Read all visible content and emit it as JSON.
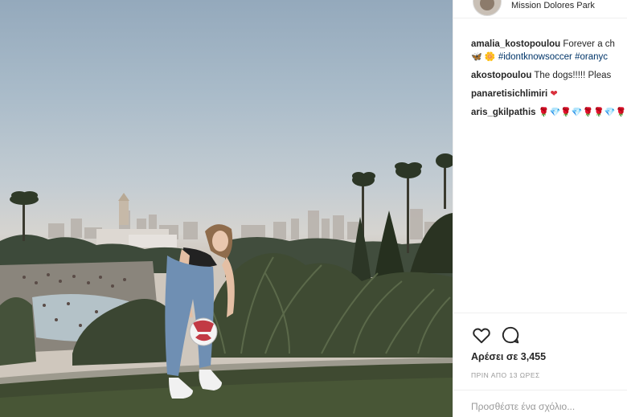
{
  "post": {
    "location": "Mission Dolores Park",
    "caption": {
      "user": "amalia_kostopoulou",
      "text": "Forever a ch",
      "emoji1": "🦋",
      "emoji2": "🌼",
      "hashtag1": "#idontknowsoccer",
      "hashtag2": "#oranyc"
    },
    "comments": [
      {
        "user": "akostopoulou",
        "text": "The dogs!!!!! Pleas"
      },
      {
        "user": "panaretisichlimiri",
        "emoji": "❤"
      },
      {
        "user": "aris_gkilpathis",
        "emoji": "🌹💎🌹💎🌹🌹💎🌹"
      }
    ],
    "likes": "Αρέσει σε 3,455",
    "time": "ΠΡΙΝ ΑΠΟ 13 ΩΡΕΣ",
    "add_comment_placeholder": "Προσθέστε ένα σχόλιο..."
  },
  "icons": {
    "like": "heart-outline-icon",
    "comment": "speech-bubble-icon",
    "comment_heart": "red-heart-icon"
  },
  "colors": {
    "text": "#262626",
    "hashtag": "#003569",
    "muted": "#999999",
    "heart_red": "#ed4956"
  }
}
